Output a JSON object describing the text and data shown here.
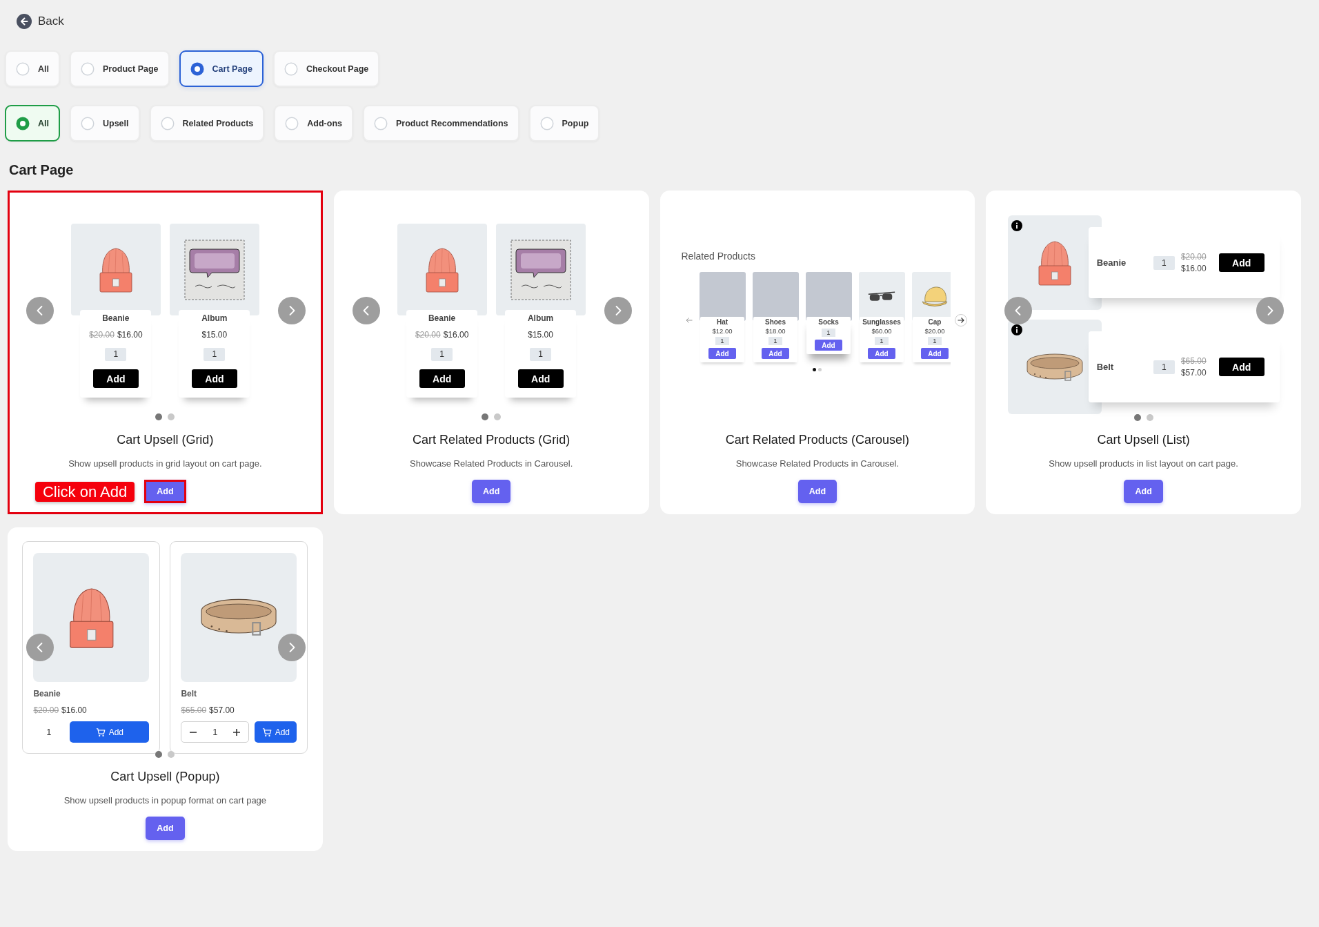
{
  "back": {
    "label": "Back"
  },
  "page_filters": [
    {
      "label": "All",
      "selected": false
    },
    {
      "label": "Product Page",
      "selected": false
    },
    {
      "label": "Cart Page",
      "selected": true
    },
    {
      "label": "Checkout Page",
      "selected": false
    }
  ],
  "type_filters": [
    {
      "label": "All",
      "selected": true
    },
    {
      "label": "Upsell",
      "selected": false
    },
    {
      "label": "Related Products",
      "selected": false
    },
    {
      "label": "Add-ons",
      "selected": false
    },
    {
      "label": "Product Recommendations",
      "selected": false
    },
    {
      "label": "Popup",
      "selected": false
    }
  ],
  "section_title": "Cart Page",
  "templates": [
    {
      "kind": "grid",
      "highlighted": true,
      "annotation": "Click on Add",
      "title": "Cart Upsell (Grid)",
      "description": "Show upsell products in grid layout on cart page.",
      "button": "Add",
      "preview": {
        "products": [
          {
            "kind": "beanie",
            "name": "Beanie",
            "old_price": "$20.00",
            "price": "$16.00",
            "quantity": "1",
            "button": "Add"
          },
          {
            "kind": "album",
            "name": "Album",
            "price": "$15.00",
            "quantity": "1",
            "button": "Add"
          }
        ],
        "pages": [
          {
            "selected": true
          },
          {
            "selected": false
          }
        ]
      }
    },
    {
      "kind": "grid",
      "highlighted": false,
      "title": "Cart Related Products (Grid)",
      "description": "Showcase Related Products in Carousel.",
      "button": "Add",
      "preview": {
        "products": [
          {
            "kind": "beanie",
            "name": "Beanie",
            "old_price": "$20.00",
            "price": "$16.00",
            "quantity": "1",
            "button": "Add"
          },
          {
            "kind": "album",
            "name": "Album",
            "price": "$15.00",
            "quantity": "1",
            "button": "Add"
          }
        ],
        "pages": [
          {
            "selected": true
          },
          {
            "selected": false
          }
        ]
      }
    },
    {
      "kind": "carousel",
      "highlighted": false,
      "title": "Cart Related Products (Carousel)",
      "description": "Showcase Related Products in Carousel.",
      "button": "Add",
      "preview": {
        "heading": "Related Products",
        "products": [
          {
            "kind": "photo",
            "name": "Hat",
            "price": "$12.00",
            "quantity": "1",
            "button": "Add",
            "raised": false
          },
          {
            "kind": "photo",
            "name": "Shoes",
            "price": "$18.00",
            "quantity": "1",
            "button": "Add",
            "raised": false
          },
          {
            "kind": "photo",
            "name": "Socks",
            "quantity": "1",
            "button": "Add",
            "raised": true
          },
          {
            "kind": "sunglasses",
            "name": "Sunglasses",
            "price": "$60.00",
            "quantity": "1",
            "button": "Add",
            "raised": false
          },
          {
            "kind": "cap",
            "name": "Cap",
            "price": "$20.00",
            "quantity": "1",
            "button": "Add",
            "raised": false
          }
        ],
        "pages": [
          {
            "selected": true
          },
          {
            "selected": false
          }
        ]
      }
    },
    {
      "kind": "list",
      "highlighted": false,
      "title": "Cart Upsell (List)",
      "description": "Show upsell products in list layout on cart page.",
      "button": "Add",
      "preview": {
        "products": [
          {
            "kind": "beanie",
            "name": "Beanie",
            "quantity": "1",
            "old_price": "$20.00",
            "price": "$16.00",
            "button": "Add"
          },
          {
            "kind": "belt",
            "name": "Belt",
            "quantity": "1",
            "old_price": "$65.00",
            "price": "$57.00",
            "button": "Add"
          }
        ],
        "pages": [
          {
            "selected": true
          },
          {
            "selected": false
          }
        ]
      }
    },
    {
      "kind": "popup",
      "highlighted": false,
      "title": "Cart Upsell (Popup)",
      "description": "Show upsell products in popup format on cart page",
      "button": "Add",
      "preview": {
        "products": [
          {
            "kind": "beanie",
            "name": "Beanie",
            "old_price": "$20.00",
            "price": "$16.00",
            "quantity": "1",
            "stepper": false,
            "button": "Add"
          },
          {
            "kind": "belt",
            "name": "Belt",
            "old_price": "$65.00",
            "price": "$57.00",
            "quantity": "1",
            "stepper": true,
            "button": "Add"
          }
        ],
        "pages": [
          {
            "selected": true
          },
          {
            "selected": false
          }
        ]
      }
    }
  ]
}
